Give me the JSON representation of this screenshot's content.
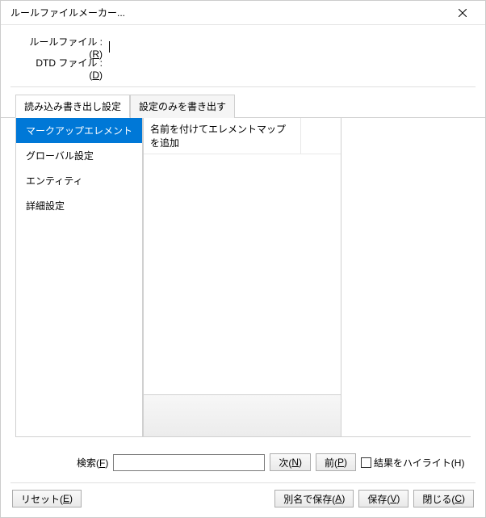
{
  "window": {
    "title": "ルールファイルメーカー..."
  },
  "files": {
    "ruleLabelPrefix": "ルールファイル :(",
    "ruleLabelKey": "R",
    "ruleLabelSuffix": ")",
    "dtdLabelPrefix": "DTD ファイル :(",
    "dtdLabelKey": "D",
    "dtdLabelSuffix": ")"
  },
  "tabs": {
    "tab0": "読み込み書き出し設定",
    "tab1": "設定のみを書き出す"
  },
  "sidebar": {
    "items": {
      "0": "マークアップエレメント",
      "1": "グローバル設定",
      "2": "エンティティ",
      "3": "詳細設定"
    }
  },
  "list": {
    "header0": "名前を付けてエレメントマップを追加"
  },
  "search": {
    "labelPrefix": "検索(",
    "labelKey": "F",
    "labelSuffix": ")",
    "value": "",
    "nextPrefix": "次(",
    "nextKey": "N",
    "nextSuffix": ")",
    "prevPrefix": "前(",
    "prevKey": "P",
    "prevSuffix": ")",
    "highlightPrefix": "結果をハイライト(",
    "highlightKey": "H",
    "highlightSuffix": ")"
  },
  "buttons": {
    "resetPrefix": "リセット(",
    "resetKey": "E",
    "resetSuffix": ")",
    "saveAsPrefix": "別名で保存(",
    "saveAsKey": "A",
    "saveAsSuffix": ")",
    "savePrefix": "保存(",
    "saveKey": "V",
    "saveSuffix": ")",
    "closePrefix": "閉じる(",
    "closeKey": "C",
    "closeSuffix": ")"
  }
}
